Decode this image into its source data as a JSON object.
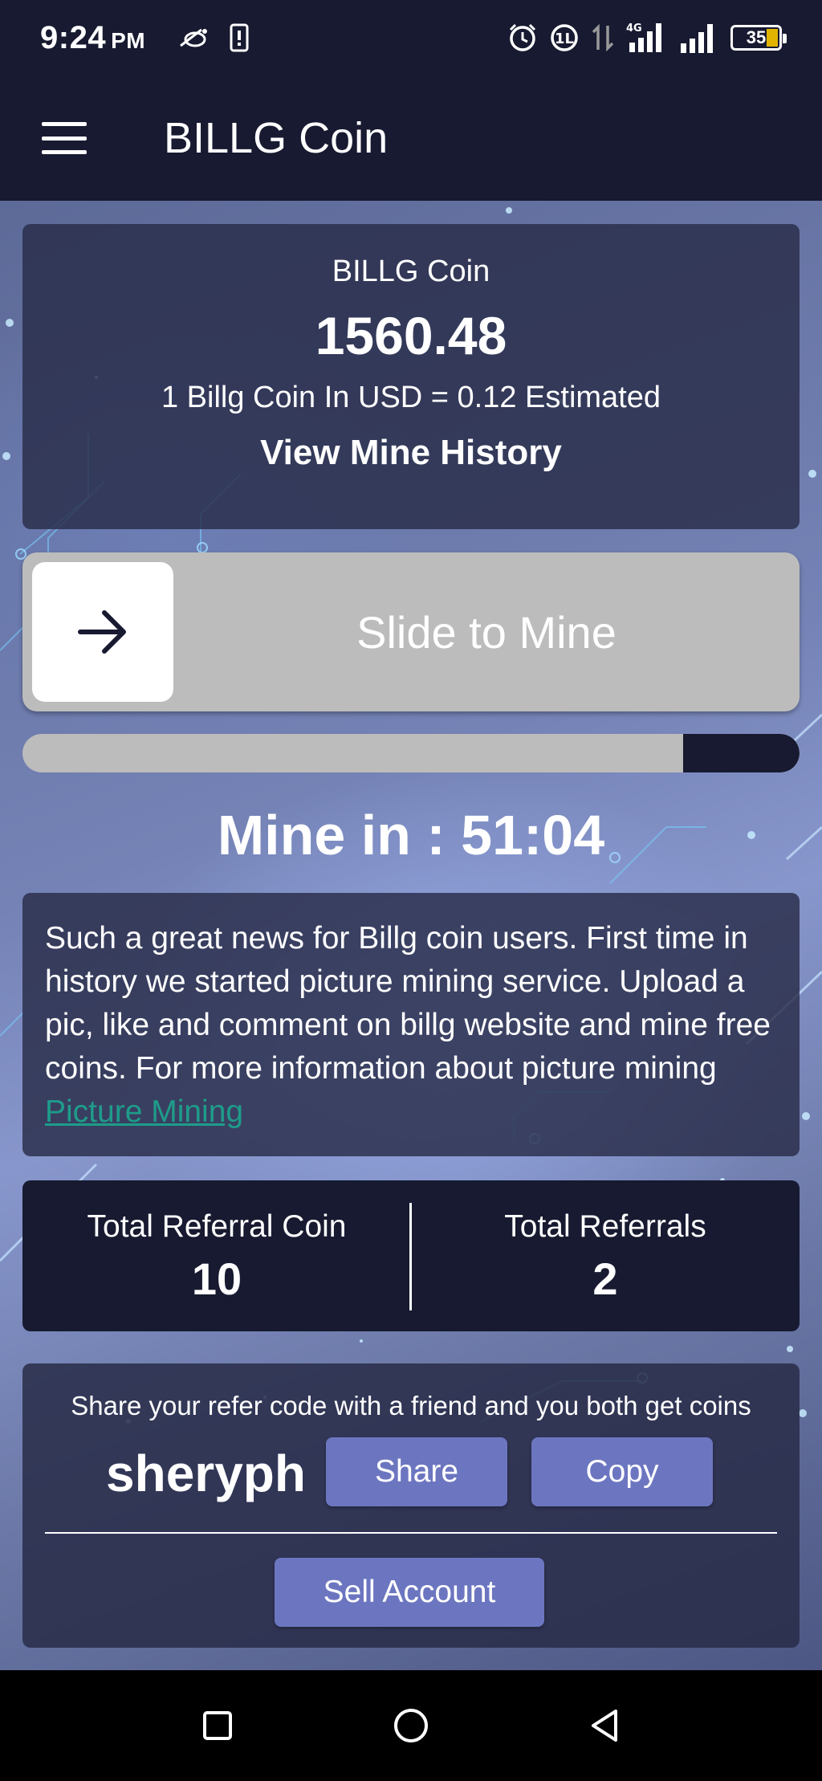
{
  "status_bar": {
    "time": "9:24",
    "ampm": "PM",
    "network": "4G",
    "battery": "35"
  },
  "app_bar": {
    "title": "BILLG Coin",
    "menu_icon": "hamburger-menu-icon"
  },
  "balance_card": {
    "label": "BILLG Coin",
    "balance": "1560.48",
    "rate_text": "1 Billg Coin In USD = 0.12 Estimated",
    "history_link": "View Mine History"
  },
  "slider": {
    "label": "Slide to Mine",
    "icon": "arrow-right-icon"
  },
  "mining_progress": {
    "remaining_fraction": 0.15
  },
  "countdown": {
    "text": "Mine in : 51:04"
  },
  "news": {
    "text": "Such a great news for Billg coin users. First time in history we started picture mining service. Upload a pic, like and comment on billg website and mine free coins. For more information about picture mining ",
    "link_text": "Picture Mining"
  },
  "referral_stats": {
    "coin_label": "Total Referral Coin",
    "coin_value": "10",
    "count_label": "Total Referrals",
    "count_value": "2"
  },
  "share": {
    "text": "Share your refer code with a friend and you both get coins",
    "code": "sheryph",
    "share_label": "Share",
    "copy_label": "Copy",
    "sell_label": "Sell Account"
  },
  "colors": {
    "dark": "#171a30",
    "button": "#6c76c0",
    "link": "#1e9c8a",
    "slider": "#bcbcbc"
  }
}
